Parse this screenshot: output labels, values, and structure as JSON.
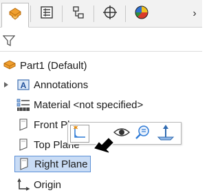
{
  "tabs": [
    {
      "name": "feature-manager-tab",
      "icon": "part-feature-icon",
      "active": true
    },
    {
      "name": "property-manager-tab",
      "icon": "property-manager-icon",
      "active": false
    },
    {
      "name": "configuration-manager-tab",
      "icon": "configuration-manager-icon",
      "active": false
    },
    {
      "name": "dimxpert-manager-tab",
      "icon": "crosshair-icon",
      "active": false
    },
    {
      "name": "display-manager-tab",
      "icon": "display-manager-icon",
      "active": false
    }
  ],
  "more_glyph": "›",
  "tree": {
    "root": {
      "label": "Part1  (Default)",
      "icon": "part-icon"
    },
    "items": [
      {
        "label": "Annotations",
        "icon": "annotations-icon",
        "expandable": true
      },
      {
        "label": "Material <not specified>",
        "icon": "material-icon",
        "expandable": false
      },
      {
        "label": "Front Plane",
        "icon": "plane-icon",
        "expandable": false
      },
      {
        "label": "Top Plane",
        "icon": "plane-icon",
        "expandable": false
      },
      {
        "label": "Right Plane",
        "icon": "plane-icon",
        "expandable": false,
        "selected": true
      },
      {
        "label": "Origin",
        "icon": "origin-icon",
        "expandable": false
      }
    ]
  },
  "context_toolbar": {
    "buttons": [
      {
        "name": "sketch-button",
        "icon": "sketch-icon"
      },
      {
        "name": "show-hide-button",
        "icon": "eye-icon"
      },
      {
        "name": "zoom-to-selection-button",
        "icon": "zoom-icon"
      },
      {
        "name": "normal-to-button",
        "icon": "normal-to-icon"
      }
    ]
  },
  "colors": {
    "part_orange": "#f0a030",
    "selection_bg": "#c9dcf5",
    "selection_border": "#5b8fd6",
    "sketch_blue": "#2f7bd6"
  }
}
